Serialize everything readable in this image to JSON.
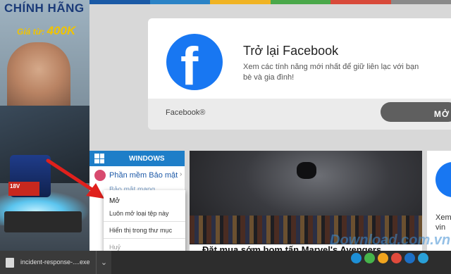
{
  "ad": {
    "title": "CHÍNH HÃNG",
    "price_prefix": "Giá từ:",
    "price_value": "400K",
    "battery_text": "18V"
  },
  "colorbar": [
    "#1b5aa6",
    "#2b83c6",
    "#f0b323",
    "#4aa84a",
    "#d84a3a",
    "#8a8a8a"
  ],
  "facebook": {
    "logo_glyph": "f",
    "title": "Trở lại Facebook",
    "description": "Xem các tính năng mới nhất để giữ liên lạc với bạn bè và gia đình!",
    "brand": "Facebook®",
    "open_label": "MỞ"
  },
  "windows_menu": {
    "header": "WINDOWS",
    "items": [
      {
        "label": "Phần mềm Bảo mật",
        "arrow": "›"
      },
      {
        "label": "Bảo mật mạng"
      }
    ]
  },
  "video": {
    "title": "Đặt mua sớm bom tấn Marvel's Avengers"
  },
  "side_card": {
    "text_line1": "Xem",
    "text_line2": "vin"
  },
  "context_menu": {
    "items": [
      {
        "label": "Mở",
        "selected": true
      },
      {
        "label": "Luôn mở loại tệp này"
      },
      {
        "label": "Hiển thị trong thư mục"
      },
      {
        "label": "Huỷ",
        "disabled": true
      }
    ]
  },
  "download": {
    "filename": "incident-response-....exe",
    "chevron_icon": "chevron-down-icon"
  },
  "watermark": {
    "text": "Download.com.vn",
    "dots": [
      "#1d8fd6",
      "#46b44b",
      "#f0a41e",
      "#e04a3c",
      "#1d6fc4",
      "#29a0d8"
    ]
  }
}
